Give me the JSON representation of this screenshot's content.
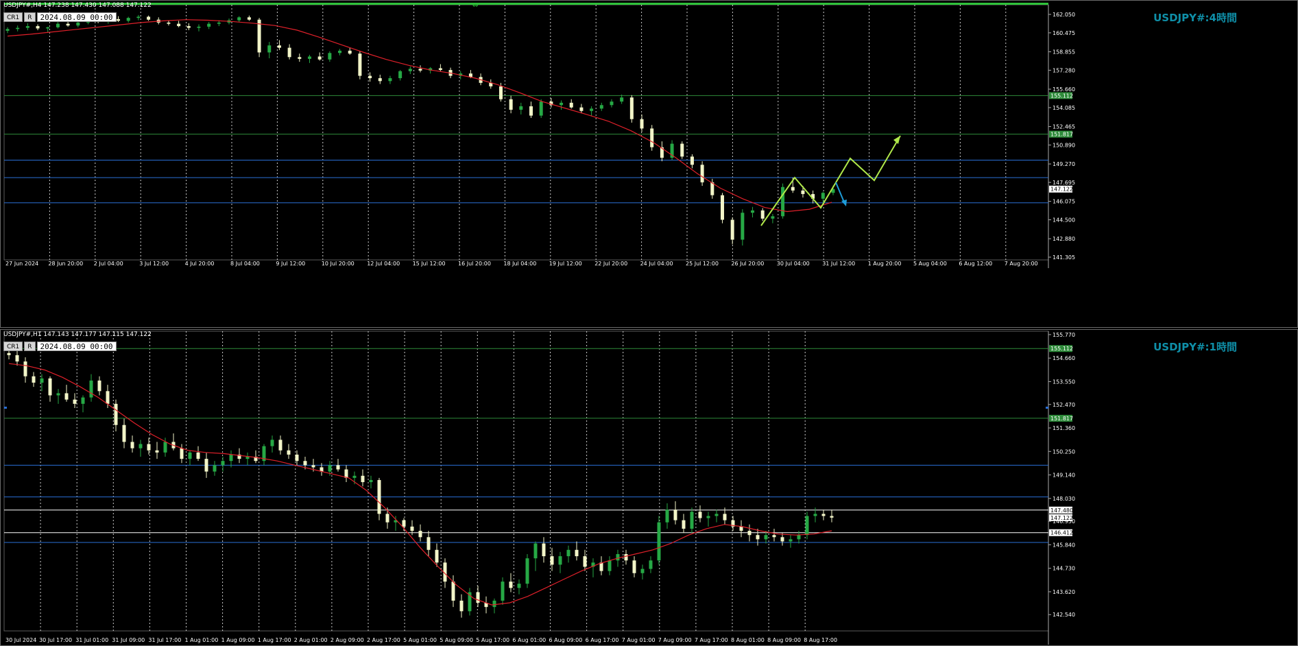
{
  "top_panel": {
    "header": "USDJPY#,H4  147.238 147.430 147.088 147.122",
    "cr_label": "CR1",
    "r_label": "R",
    "date_value": "2024.08.09 00:00",
    "watermark": "USDJPY#:4時間",
    "price_ticks": [
      "162.050",
      "160.475",
      "158.855",
      "157.280",
      "155.660",
      "154.085",
      "152.465",
      "150.890",
      "149.270",
      "147.695",
      "146.075",
      "144.500",
      "142.880",
      "141.305"
    ],
    "price_range": [
      141.305,
      162.05
    ],
    "time_labels": [
      "27 Jun 2024",
      "28 Jun 20:00",
      "2 Jul 04:00",
      "3 Jul 12:00",
      "4 Jul 20:00",
      "8 Jul 04:00",
      "9 Jul 12:00",
      "10 Jul 20:00",
      "12 Jul 04:00",
      "15 Jul 12:00",
      "16 Jul 20:00",
      "18 Jul 04:00",
      "19 Jul 12:00",
      "22 Jul 20:00",
      "24 Jul 04:00",
      "25 Jul 12:00",
      "26 Jul 20:00",
      "30 Jul 04:00",
      "31 Jul 12:00",
      "1 Aug 20:00",
      "5 Aug 04:00",
      "6 Aug 12:00",
      "7 Aug 20:00"
    ],
    "hlines": [
      {
        "price": 155.112,
        "color": "#2e8b3a",
        "badge": "155.112",
        "badge_bg": "#2e8b3a"
      },
      {
        "price": 151.817,
        "color": "#2e8b3a",
        "badge": "151.817",
        "badge_bg": "#2e8b3a"
      },
      {
        "price": 149.6,
        "color": "#2a6fd6"
      },
      {
        "price": 148.1,
        "color": "#2a6fd6"
      },
      {
        "price": 145.95,
        "color": "#2a6fd6"
      }
    ],
    "current_price_badge": "147.122",
    "current_price": 147.122,
    "candles": [
      [
        160.65,
        160.95,
        160.45,
        160.8
      ],
      [
        160.8,
        161.1,
        160.6,
        160.9
      ],
      [
        160.9,
        161.3,
        160.7,
        161.05
      ],
      [
        161.05,
        161.2,
        160.7,
        160.85
      ],
      [
        160.85,
        161.0,
        160.5,
        160.95
      ],
      [
        160.95,
        161.4,
        160.85,
        161.25
      ],
      [
        161.25,
        161.5,
        161.0,
        161.1
      ],
      [
        161.1,
        161.45,
        160.95,
        161.35
      ],
      [
        161.35,
        161.7,
        161.2,
        161.55
      ],
      [
        161.55,
        161.8,
        161.3,
        161.4
      ],
      [
        161.4,
        161.75,
        161.25,
        161.65
      ],
      [
        161.65,
        161.9,
        161.4,
        161.5
      ],
      [
        161.5,
        161.85,
        161.35,
        161.75
      ],
      [
        161.75,
        162.0,
        161.55,
        161.85
      ],
      [
        161.85,
        161.95,
        161.5,
        161.6
      ],
      [
        161.6,
        161.8,
        161.2,
        161.35
      ],
      [
        161.35,
        161.55,
        161.1,
        161.25
      ],
      [
        161.25,
        161.5,
        160.95,
        161.05
      ],
      [
        161.05,
        161.3,
        160.7,
        160.9
      ],
      [
        160.9,
        161.2,
        160.6,
        161.0
      ],
      [
        161.0,
        161.4,
        160.8,
        161.25
      ],
      [
        161.25,
        161.55,
        161.05,
        161.35
      ],
      [
        161.35,
        161.7,
        161.2,
        161.55
      ],
      [
        161.55,
        161.9,
        161.4,
        161.8
      ],
      [
        161.8,
        161.95,
        161.5,
        161.6
      ],
      [
        161.6,
        161.75,
        158.4,
        158.8
      ],
      [
        158.8,
        159.7,
        158.3,
        159.4
      ],
      [
        159.4,
        159.85,
        159.0,
        159.2
      ],
      [
        159.2,
        159.5,
        158.2,
        158.4
      ],
      [
        158.4,
        158.7,
        158.0,
        158.25
      ],
      [
        158.25,
        158.6,
        157.9,
        158.45
      ],
      [
        158.45,
        158.8,
        158.1,
        158.2
      ],
      [
        158.2,
        158.9,
        158.0,
        158.75
      ],
      [
        158.75,
        159.1,
        158.55,
        158.95
      ],
      [
        158.95,
        159.2,
        158.6,
        158.7
      ],
      [
        158.7,
        158.9,
        156.5,
        156.8
      ],
      [
        156.8,
        157.1,
        156.3,
        156.6
      ],
      [
        156.6,
        156.9,
        156.1,
        156.35
      ],
      [
        156.35,
        156.8,
        156.1,
        156.6
      ],
      [
        156.6,
        157.3,
        156.4,
        157.2
      ],
      [
        157.2,
        157.6,
        156.95,
        157.4
      ],
      [
        157.4,
        157.7,
        157.1,
        157.25
      ],
      [
        157.25,
        157.55,
        157.0,
        157.45
      ],
      [
        157.45,
        157.8,
        157.2,
        157.3
      ],
      [
        157.3,
        157.5,
        156.6,
        156.8
      ],
      [
        156.8,
        157.2,
        156.5,
        157.0
      ],
      [
        157.0,
        157.3,
        156.6,
        156.7
      ],
      [
        156.7,
        157.0,
        156.0,
        156.2
      ],
      [
        156.2,
        156.5,
        155.7,
        155.9
      ],
      [
        155.9,
        156.2,
        154.6,
        154.8
      ],
      [
        154.8,
        155.1,
        153.6,
        153.9
      ],
      [
        153.9,
        154.5,
        153.5,
        154.2
      ],
      [
        154.2,
        154.6,
        153.2,
        153.4
      ],
      [
        153.4,
        154.8,
        153.2,
        154.6
      ],
      [
        154.6,
        154.9,
        154.1,
        154.3
      ],
      [
        154.3,
        154.7,
        153.9,
        154.5
      ],
      [
        154.5,
        154.8,
        154.0,
        154.1
      ],
      [
        154.1,
        154.4,
        153.6,
        153.8
      ],
      [
        153.8,
        154.2,
        153.4,
        154.0
      ],
      [
        154.0,
        154.5,
        153.8,
        154.3
      ],
      [
        154.3,
        154.8,
        154.1,
        154.6
      ],
      [
        154.6,
        155.2,
        154.4,
        154.95
      ],
      [
        154.95,
        155.15,
        152.8,
        153.1
      ],
      [
        153.1,
        153.5,
        152.0,
        152.3
      ],
      [
        152.3,
        152.6,
        150.4,
        150.7
      ],
      [
        150.7,
        151.2,
        149.5,
        149.8
      ],
      [
        149.8,
        151.3,
        149.6,
        151.0
      ],
      [
        151.0,
        151.2,
        149.7,
        149.9
      ],
      [
        149.9,
        150.1,
        148.9,
        149.2
      ],
      [
        149.2,
        149.5,
        147.4,
        147.7
      ],
      [
        147.7,
        148.0,
        146.3,
        146.6
      ],
      [
        146.6,
        146.8,
        144.2,
        144.5
      ],
      [
        144.5,
        144.7,
        142.4,
        142.8
      ],
      [
        142.8,
        145.4,
        142.3,
        145.1
      ],
      [
        145.1,
        145.6,
        144.7,
        145.3
      ],
      [
        145.3,
        145.5,
        144.4,
        144.6
      ],
      [
        144.6,
        145.0,
        144.2,
        144.8
      ],
      [
        144.8,
        147.6,
        144.6,
        147.3
      ],
      [
        147.3,
        148.1,
        146.8,
        147.0
      ],
      [
        147.0,
        147.4,
        146.4,
        146.7
      ],
      [
        146.7,
        147.0,
        145.9,
        146.3
      ],
      [
        146.3,
        146.9,
        146.0,
        146.8
      ],
      [
        146.8,
        147.43,
        146.6,
        147.122
      ]
    ],
    "ma": [
      160.2,
      160.35,
      160.55,
      160.75,
      160.95,
      161.15,
      161.35,
      161.5,
      161.6,
      161.55,
      161.45,
      161.3,
      161.1,
      160.7,
      160.1,
      159.45,
      158.8,
      158.2,
      157.7,
      157.3,
      157.0,
      156.6,
      156.05,
      155.35,
      154.6,
      154.05,
      153.5,
      152.9,
      152.1,
      151.1,
      149.8,
      148.4,
      147.2,
      146.3,
      145.55,
      145.2,
      145.4,
      146.0
    ]
  },
  "bottom_panel": {
    "header": "USDJPY#,H1  147.143 147.177 147.115 147.122",
    "cr_label": "CR1",
    "r_label": "R",
    "date_value": "2024.08.09 00:00",
    "watermark": "USDJPY#:1時間",
    "price_ticks": [
      "155.770",
      "154.660",
      "153.550",
      "152.470",
      "151.360",
      "150.250",
      "149.140",
      "148.030",
      "146.950",
      "145.840",
      "144.730",
      "143.620",
      "142.540"
    ],
    "price_range": [
      141.9,
      155.8
    ],
    "time_labels": [
      "30 Jul 2024",
      "30 Jul 17:00",
      "31 Jul 01:00",
      "31 Jul 09:00",
      "31 Jul 17:00",
      "1 Aug 01:00",
      "1 Aug 09:00",
      "1 Aug 17:00",
      "2 Aug 01:00",
      "2 Aug 09:00",
      "2 Aug 17:00",
      "5 Aug 01:00",
      "5 Aug 09:00",
      "5 Aug 17:00",
      "6 Aug 01:00",
      "6 Aug 09:00",
      "6 Aug 17:00",
      "7 Aug 01:00",
      "7 Aug 09:00",
      "7 Aug 17:00",
      "8 Aug 01:00",
      "8 Aug 09:00",
      "8 Aug 17:00"
    ],
    "hlines": [
      {
        "price": 155.112,
        "color": "#2e8b3a",
        "badge": "155.112",
        "badge_bg": "#2e8b3a"
      },
      {
        "price": 151.817,
        "color": "#2e8b3a",
        "badge": "151.817",
        "badge_bg": "#2e8b3a"
      },
      {
        "price": 149.6,
        "color": "#2a6fd6"
      },
      {
        "price": 148.1,
        "color": "#2a6fd6"
      },
      {
        "price": 147.48,
        "color": "#ffffff",
        "badge": "147.480",
        "badge_bg": "#ffffff"
      },
      {
        "price": 146.412,
        "color": "#ffffff",
        "badge": "146.412",
        "badge_bg": "#ffffff"
      },
      {
        "price": 145.95,
        "color": "#2a6fd6"
      }
    ],
    "current_price_badge": "147.122",
    "current_price": 147.122,
    "candles": [
      [
        154.9,
        155.2,
        154.6,
        154.8
      ],
      [
        154.8,
        155.0,
        154.3,
        154.5
      ],
      [
        154.5,
        154.7,
        153.5,
        153.8
      ],
      [
        153.8,
        154.0,
        153.3,
        153.5
      ],
      [
        153.5,
        153.9,
        153.1,
        153.7
      ],
      [
        153.7,
        153.8,
        152.6,
        152.9
      ],
      [
        152.9,
        153.2,
        152.5,
        153.0
      ],
      [
        153.0,
        153.4,
        152.6,
        152.7
      ],
      [
        152.7,
        153.0,
        152.3,
        152.5
      ],
      [
        152.5,
        152.9,
        152.1,
        152.8
      ],
      [
        152.8,
        153.9,
        152.6,
        153.6
      ],
      [
        153.6,
        153.8,
        152.9,
        153.1
      ],
      [
        153.1,
        153.4,
        152.3,
        152.5
      ],
      [
        152.5,
        152.7,
        151.2,
        151.5
      ],
      [
        151.5,
        151.8,
        150.4,
        150.7
      ],
      [
        150.7,
        151.0,
        150.2,
        150.4
      ],
      [
        150.4,
        150.8,
        150.0,
        150.6
      ],
      [
        150.6,
        150.9,
        150.1,
        150.3
      ],
      [
        150.3,
        150.7,
        149.9,
        150.2
      ],
      [
        150.2,
        150.9,
        150.0,
        150.7
      ],
      [
        150.7,
        151.1,
        150.3,
        150.4
      ],
      [
        150.4,
        150.6,
        149.7,
        149.9
      ],
      [
        149.9,
        150.3,
        149.6,
        150.2
      ],
      [
        150.2,
        150.5,
        149.8,
        149.9
      ],
      [
        149.9,
        150.2,
        149.0,
        149.3
      ],
      [
        149.3,
        149.8,
        149.1,
        149.6
      ],
      [
        149.6,
        150.0,
        149.3,
        149.8
      ],
      [
        149.8,
        150.3,
        149.5,
        150.1
      ],
      [
        150.1,
        150.4,
        149.7,
        149.9
      ],
      [
        149.9,
        150.2,
        149.6,
        150.0
      ],
      [
        150.0,
        150.3,
        149.7,
        149.8
      ],
      [
        149.8,
        150.6,
        149.6,
        150.5
      ],
      [
        150.5,
        151.0,
        150.2,
        150.8
      ],
      [
        150.8,
        151.0,
        150.1,
        150.3
      ],
      [
        150.3,
        150.6,
        149.9,
        150.1
      ],
      [
        150.1,
        150.3,
        149.6,
        149.8
      ],
      [
        149.8,
        150.0,
        149.4,
        149.6
      ],
      [
        149.6,
        149.9,
        149.3,
        149.5
      ],
      [
        149.5,
        149.7,
        149.1,
        149.3
      ],
      [
        149.3,
        149.8,
        149.1,
        149.6
      ],
      [
        149.6,
        149.9,
        149.3,
        149.4
      ],
      [
        149.4,
        149.6,
        148.8,
        149.0
      ],
      [
        149.0,
        149.3,
        148.7,
        149.1
      ],
      [
        149.1,
        149.4,
        148.6,
        148.8
      ],
      [
        148.8,
        149.1,
        148.5,
        148.9
      ],
      [
        148.9,
        149.0,
        147.0,
        147.3
      ],
      [
        147.3,
        147.6,
        146.6,
        146.9
      ],
      [
        146.9,
        147.2,
        146.5,
        147.0
      ],
      [
        147.0,
        147.1,
        146.5,
        146.7
      ],
      [
        146.7,
        147.0,
        146.3,
        146.5
      ],
      [
        146.5,
        146.8,
        146.0,
        146.2
      ],
      [
        146.2,
        146.5,
        145.3,
        145.6
      ],
      [
        145.6,
        145.9,
        144.8,
        145.0
      ],
      [
        145.0,
        145.2,
        143.8,
        144.1
      ],
      [
        144.1,
        144.4,
        142.9,
        143.2
      ],
      [
        143.2,
        143.5,
        142.4,
        142.7
      ],
      [
        142.7,
        143.8,
        142.5,
        143.6
      ],
      [
        143.6,
        143.9,
        142.9,
        143.1
      ],
      [
        143.1,
        143.4,
        142.6,
        142.9
      ],
      [
        142.9,
        143.3,
        142.6,
        143.2
      ],
      [
        143.2,
        144.3,
        143.0,
        144.1
      ],
      [
        144.1,
        144.5,
        143.6,
        143.8
      ],
      [
        143.8,
        144.2,
        143.5,
        144.0
      ],
      [
        144.0,
        145.4,
        143.8,
        145.2
      ],
      [
        145.2,
        146.0,
        144.6,
        145.9
      ],
      [
        145.9,
        146.2,
        145.0,
        145.3
      ],
      [
        145.3,
        145.7,
        144.6,
        144.9
      ],
      [
        144.9,
        145.5,
        144.5,
        145.3
      ],
      [
        145.3,
        145.8,
        145.0,
        145.6
      ],
      [
        145.6,
        146.0,
        145.1,
        145.3
      ],
      [
        145.3,
        145.6,
        144.6,
        144.8
      ],
      [
        144.8,
        145.2,
        144.3,
        145.0
      ],
      [
        145.0,
        145.3,
        144.4,
        144.6
      ],
      [
        144.6,
        145.3,
        144.4,
        145.1
      ],
      [
        145.1,
        145.6,
        144.8,
        145.4
      ],
      [
        145.4,
        145.6,
        144.9,
        145.1
      ],
      [
        145.1,
        145.3,
        144.3,
        144.5
      ],
      [
        144.5,
        144.9,
        144.2,
        144.7
      ],
      [
        144.7,
        145.3,
        144.5,
        145.1
      ],
      [
        145.1,
        147.2,
        144.9,
        146.9
      ],
      [
        146.9,
        147.8,
        146.6,
        147.5
      ],
      [
        147.5,
        147.9,
        146.8,
        147.0
      ],
      [
        147.0,
        147.3,
        146.4,
        146.6
      ],
      [
        146.6,
        147.6,
        146.4,
        147.4
      ],
      [
        147.4,
        147.7,
        146.9,
        147.1
      ],
      [
        147.1,
        147.4,
        146.7,
        147.2
      ],
      [
        147.2,
        147.5,
        146.9,
        147.3
      ],
      [
        147.3,
        147.6,
        146.8,
        147.0
      ],
      [
        147.0,
        147.2,
        146.5,
        146.7
      ],
      [
        146.7,
        147.0,
        146.2,
        146.5
      ],
      [
        146.5,
        146.8,
        146.0,
        146.3
      ],
      [
        146.3,
        146.6,
        145.8,
        146.1
      ],
      [
        146.1,
        146.5,
        145.9,
        146.3
      ],
      [
        146.3,
        146.6,
        146.0,
        146.2
      ],
      [
        146.2,
        146.4,
        145.8,
        146.0
      ],
      [
        146.0,
        146.3,
        145.7,
        146.1
      ],
      [
        146.1,
        146.5,
        145.9,
        146.3
      ],
      [
        146.3,
        147.4,
        146.1,
        147.2
      ],
      [
        147.2,
        147.6,
        146.9,
        147.3
      ],
      [
        147.3,
        147.5,
        147.0,
        147.2
      ],
      [
        147.2,
        147.5,
        146.9,
        147.122
      ]
    ],
    "ma": [
      154.4,
      154.3,
      154.1,
      153.75,
      153.3,
      152.8,
      152.2,
      151.6,
      151.05,
      150.6,
      150.3,
      150.2,
      150.15,
      150.05,
      149.95,
      149.8,
      149.6,
      149.4,
      149.2,
      149.0,
      148.4,
      147.6,
      146.7,
      145.7,
      144.8,
      143.95,
      143.3,
      143.0,
      143.1,
      143.4,
      143.8,
      144.2,
      144.6,
      144.95,
      145.2,
      145.4,
      145.6,
      145.9,
      146.3,
      146.6,
      146.8,
      146.7,
      146.5,
      146.35,
      146.3,
      146.35,
      146.5
    ]
  },
  "colors": {
    "bull": "#26a845",
    "bear": "#f2f5c8",
    "ma": "#e0202a",
    "grid": "#cccccc",
    "arrow_green": "#b0e84a",
    "arrow_blue": "#1e9cd8",
    "watermark": "#0f8fa8"
  }
}
